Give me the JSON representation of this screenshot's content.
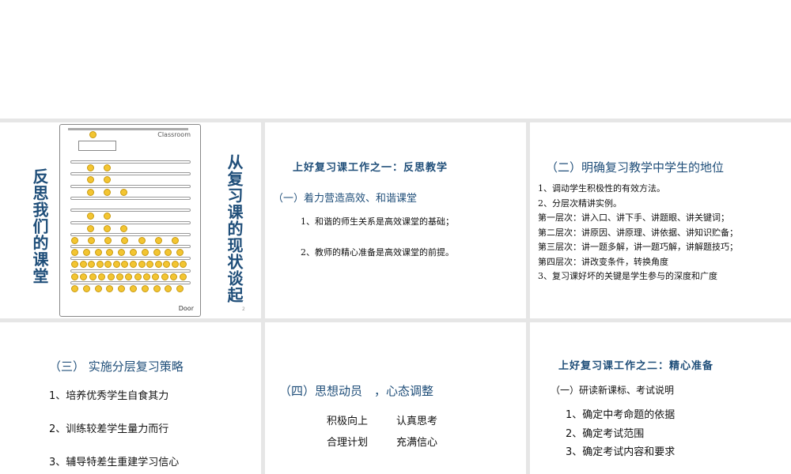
{
  "slides": [
    {
      "title_left": "反思我们的课堂",
      "title_right": "从复习课的现状谈起",
      "classroom_label": "Classroom",
      "door_label": "Door",
      "page_number": "2"
    },
    {
      "heading": "上好复习课工作之一：反思教学",
      "subheading": "（一）着力营造高效、和谐课堂",
      "items": [
        "1、和谐的师生关系是高效课堂的基础；",
        "2、教师的精心准备是高效课堂的前提。"
      ]
    },
    {
      "heading": "（二）明确复习教学中学生的地位",
      "items": [
        "1、调动学生积极性的有效方法。",
        "2、分层次精讲实例。",
        "第一层次：讲入口、讲下手、讲题眼、讲关键词；",
        "第二层次：讲原因、讲原理、讲依据、讲知识贮备；",
        "第三层次：讲一题多解，讲一题巧解，讲解题技巧；",
        "第四层次：讲改变条件，转换角度",
        "3、复习课好坏的关键是学生参与的深度和广度"
      ]
    },
    {
      "heading": "（三） 实施分层复习策略",
      "items": [
        "1、培养优秀学生自食其力",
        "2、训练较差学生量力而行",
        "3、辅导特差生重建学习信心"
      ]
    },
    {
      "heading": "（四）思想动员　，心态调整",
      "grid": [
        "积极向上",
        "认真思考",
        "合理计划",
        "充满信心"
      ]
    },
    {
      "heading": "上好复习课工作之二：精心准备",
      "subheading": "（一）研读新课标、考试说明",
      "items": [
        "1、确定中考命题的依据",
        "2、确定考试范围",
        "3、确定考试内容和要求"
      ]
    }
  ]
}
